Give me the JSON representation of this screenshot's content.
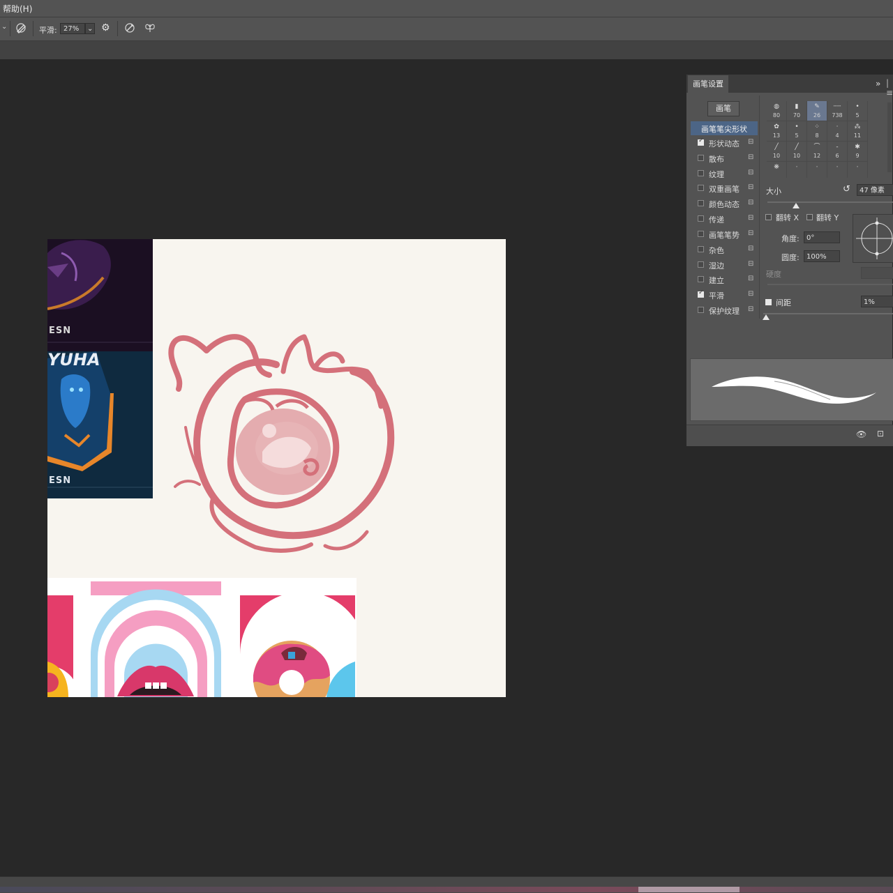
{
  "menubar": {
    "help_menu": "帮助(H)"
  },
  "options_bar": {
    "smoothing_label": "平滑:",
    "smoothing_value": "27%"
  },
  "brush_panel": {
    "tab_title": "画笔设置",
    "expand_glyph": "»",
    "brushes_button": "画笔",
    "options": [
      {
        "label": "画笔笔尖形状",
        "checked": false
      },
      {
        "label": "形状动态",
        "checked": true
      },
      {
        "label": "散布",
        "checked": false
      },
      {
        "label": "纹理",
        "checked": false
      },
      {
        "label": "双重画笔",
        "checked": false
      },
      {
        "label": "颜色动态",
        "checked": false
      },
      {
        "label": "传递",
        "checked": false
      },
      {
        "label": "画笔笔势",
        "checked": false
      },
      {
        "label": "杂色",
        "checked": false
      },
      {
        "label": "湿边",
        "checked": false
      },
      {
        "label": "建立",
        "checked": false
      },
      {
        "label": "平滑",
        "checked": true
      },
      {
        "label": "保护纹理",
        "checked": false
      }
    ],
    "presets": [
      [
        "80",
        "70",
        "26",
        "738",
        "5"
      ],
      [
        "13",
        "5",
        "8",
        "4",
        "11"
      ],
      [
        "10",
        "10",
        "12",
        "6",
        "9"
      ]
    ],
    "size_label": "大小",
    "size_value": "47 像素",
    "flip_x_label": "翻转 X",
    "flip_y_label": "翻转 Y",
    "angle_label": "角度:",
    "angle_value": "0°",
    "roundness_label": "圆度:",
    "roundness_value": "100%",
    "hardness_label": "硬度",
    "spacing_label": "间距",
    "spacing_checked": true,
    "spacing_value": "1%"
  },
  "canvas": {
    "thumb_text_1": "ESN",
    "thumb_text_2": "ESN",
    "thumb_title": "YUHA"
  },
  "colors": {
    "accent_selection": "#4c6586",
    "sketch_pink": "#d4707a",
    "canvas_bg": "#f8f5ef"
  }
}
